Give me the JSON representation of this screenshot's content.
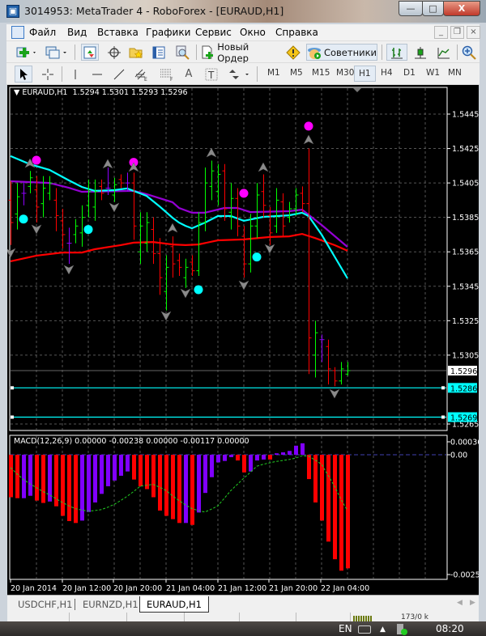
{
  "window": {
    "title": "3014953: MetaTrader 4 - RoboForex - [EURAUD,H1]",
    "min": "—",
    "max": "□",
    "close": "X"
  },
  "menu": [
    "Файл",
    "Вид",
    "Вставка",
    "Графики",
    "Сервис",
    "Окно",
    "Справка"
  ],
  "mdi": {
    "min": "_",
    "restore": "❐",
    "close": "×"
  },
  "toolbar1": {
    "new_order": "Новый Ордер",
    "experts": "Советники"
  },
  "toolbar2": {
    "timeframes": [
      "M1",
      "M5",
      "M15",
      "M30",
      "H1",
      "H4",
      "D1",
      "W1",
      "MN"
    ],
    "active": "H1",
    "fibo_e": "E",
    "fibo_f": "F",
    "text_tool": "A",
    "label_tool": "T"
  },
  "chart": {
    "header": "EURAUD,H1  1.5294 1.5301 1.5293 1.5296",
    "symbol": "EURAUD",
    "timeframe": "H1",
    "price_ticks": [
      "1.5445",
      "1.5425",
      "1.5405",
      "1.5385",
      "1.5365",
      "1.5345",
      "1.5325",
      "1.5305",
      "1.5265"
    ],
    "current_price": "1.5296",
    "hlines": [
      {
        "price": "1.5286",
        "color": "#00ffff"
      },
      {
        "price": "1.5269",
        "color": "#00ffff"
      }
    ],
    "time_labels": [
      "20 Jan 2014",
      "20 Jan 12:00",
      "20 Jan 20:00",
      "21 Jan 04:00",
      "21 Jan 12:00",
      "21 Jan 20:00",
      "22 Jan 04:00"
    ],
    "colors": {
      "up": "#00ff00",
      "down": "#ff0000",
      "doji": "#9000ff",
      "ma_fast": "#00ffff",
      "ma_mid": "#9400d3",
      "ma_slow": "#ff0000",
      "dot_high": "#ff00ff",
      "dot_low": "#00ffff",
      "arrow": "#8a8a8a"
    }
  },
  "chart_data": [
    {
      "type": "ohlc",
      "series": "EURAUD,H1",
      "ylim": [
        1.5262,
        1.5461
      ],
      "ohlc": [
        [
          1.5395,
          1.5406,
          1.5369,
          1.5382
        ],
        [
          1.5387,
          1.5405,
          1.5378,
          1.5397
        ],
        [
          1.5399,
          1.5406,
          1.5392,
          1.5399
        ],
        [
          1.5403,
          1.5412,
          1.5399,
          1.5408
        ],
        [
          1.5401,
          1.5409,
          1.5382,
          1.5391
        ],
        [
          1.5393,
          1.5409,
          1.5385,
          1.5402
        ],
        [
          1.5399,
          1.5409,
          1.5395,
          1.5405
        ],
        [
          1.5395,
          1.5402,
          1.5377,
          1.5386
        ],
        [
          1.5383,
          1.539,
          1.5367,
          1.5375
        ],
        [
          1.537,
          1.5379,
          1.5358,
          1.537
        ],
        [
          1.5375,
          1.5384,
          1.537,
          1.538
        ],
        [
          1.5376,
          1.5392,
          1.5368,
          1.5385
        ],
        [
          1.5392,
          1.5407,
          1.5385,
          1.54
        ],
        [
          1.5391,
          1.5407,
          1.5383,
          1.54
        ],
        [
          1.5403,
          1.5407,
          1.5395,
          1.5399
        ],
        [
          1.5402,
          1.5414,
          1.5398,
          1.5402
        ],
        [
          1.5398,
          1.5408,
          1.5394,
          1.5404
        ],
        [
          1.5407,
          1.541,
          1.5402,
          1.5405
        ],
        [
          1.5405,
          1.5411,
          1.54,
          1.5405
        ],
        [
          1.5405,
          1.5411,
          1.5372,
          1.538
        ],
        [
          1.5365,
          1.5388,
          1.5358,
          1.538
        ],
        [
          1.537,
          1.5388,
          1.5365,
          1.5382
        ],
        [
          1.5378,
          1.5385,
          1.5358,
          1.5364
        ],
        [
          1.5364,
          1.5373,
          1.534,
          1.535
        ],
        [
          1.5342,
          1.5363,
          1.5331,
          1.5356
        ],
        [
          1.5368,
          1.5374,
          1.535,
          1.5358
        ],
        [
          1.536,
          1.5364,
          1.5351,
          1.5356
        ],
        [
          1.535,
          1.5361,
          1.5344,
          1.5356
        ],
        [
          1.5359,
          1.5363,
          1.5351,
          1.5354
        ],
        [
          1.5354,
          1.5388,
          1.5351,
          1.5382
        ],
        [
          1.5382,
          1.5414,
          1.5377,
          1.5405
        ],
        [
          1.5403,
          1.5418,
          1.5395,
          1.5412
        ],
        [
          1.54,
          1.5416,
          1.5392,
          1.541
        ],
        [
          1.5412,
          1.5416,
          1.5383,
          1.539
        ],
        [
          1.5388,
          1.5405,
          1.5378,
          1.5396
        ],
        [
          1.5396,
          1.5402,
          1.5374,
          1.538
        ],
        [
          1.5374,
          1.538,
          1.535,
          1.5358
        ],
        [
          1.5358,
          1.5387,
          1.5353,
          1.538
        ],
        [
          1.538,
          1.5405,
          1.5373,
          1.5398
        ],
        [
          1.54,
          1.541,
          1.5385,
          1.5392
        ],
        [
          1.5386,
          1.5391,
          1.5369,
          1.5376
        ],
        [
          1.538,
          1.5402,
          1.5376,
          1.5395
        ],
        [
          1.5394,
          1.5399,
          1.5374,
          1.538
        ],
        [
          1.5385,
          1.5394,
          1.5382,
          1.539
        ],
        [
          1.539,
          1.5402,
          1.5386,
          1.5398
        ],
        [
          1.5399,
          1.5403,
          1.5388,
          1.5393
        ],
        [
          1.5393,
          1.5425,
          1.5294,
          1.5315
        ],
        [
          1.5305,
          1.5325,
          1.5292,
          1.5318
        ],
        [
          1.5314,
          1.5317,
          1.5301,
          1.5314
        ],
        [
          1.531,
          1.5314,
          1.5288,
          1.5297
        ],
        [
          1.5296,
          1.5298,
          1.5287,
          1.529
        ],
        [
          1.529,
          1.5301,
          1.5288,
          1.5297
        ],
        [
          1.5294,
          1.5301,
          1.5293,
          1.5296
        ]
      ],
      "ma_fast": [
        [
          0,
          1.54206
        ],
        [
          3,
          1.54159
        ],
        [
          6,
          1.54126
        ],
        [
          9,
          1.54065
        ],
        [
          11,
          1.54027
        ],
        [
          13,
          1.54004
        ],
        [
          16,
          1.54008
        ],
        [
          18,
          1.54018
        ],
        [
          21,
          1.53975
        ],
        [
          23,
          1.53914
        ],
        [
          25,
          1.53848
        ],
        [
          26,
          1.5382
        ],
        [
          27,
          1.53801
        ],
        [
          28,
          1.53787
        ],
        [
          30,
          1.5382
        ],
        [
          32,
          1.53858
        ],
        [
          34,
          1.53858
        ],
        [
          36,
          1.5383
        ],
        [
          39,
          1.53853
        ],
        [
          43,
          1.53862
        ],
        [
          45,
          1.53877
        ],
        [
          46,
          1.53858
        ],
        [
          48,
          1.5375
        ],
        [
          50,
          1.53623
        ],
        [
          52,
          1.53496
        ]
      ],
      "ma_mid": [
        [
          0,
          1.5406
        ],
        [
          6,
          1.5405
        ],
        [
          9,
          1.54022
        ],
        [
          11,
          1.53999
        ],
        [
          19,
          1.54004
        ],
        [
          21,
          1.53985
        ],
        [
          25,
          1.53938
        ],
        [
          26,
          1.53905
        ],
        [
          28,
          1.53877
        ],
        [
          30,
          1.53877
        ],
        [
          33,
          1.53905
        ],
        [
          35,
          1.53905
        ],
        [
          37,
          1.53881
        ],
        [
          43,
          1.53886
        ],
        [
          45,
          1.53895
        ],
        [
          48,
          1.53806
        ],
        [
          52,
          1.53679
        ]
      ],
      "ma_slow": [
        [
          0,
          1.53595
        ],
        [
          4,
          1.53628
        ],
        [
          8,
          1.53646
        ],
        [
          11,
          1.53646
        ],
        [
          13,
          1.53665
        ],
        [
          17,
          1.53689
        ],
        [
          19,
          1.53703
        ],
        [
          22,
          1.53707
        ],
        [
          25,
          1.53693
        ],
        [
          27,
          1.53689
        ],
        [
          29,
          1.53693
        ],
        [
          32,
          1.53717
        ],
        [
          36,
          1.53722
        ],
        [
          40,
          1.53736
        ],
        [
          43,
          1.5374
        ],
        [
          45,
          1.53754
        ],
        [
          47,
          1.5373
        ],
        [
          50,
          1.53689
        ],
        [
          52,
          1.53656
        ]
      ],
      "dots_high": [
        [
          4,
          1.54182
        ],
        [
          19,
          1.5417
        ],
        [
          36,
          1.5399
        ],
        [
          46,
          1.5438
        ]
      ],
      "dots_low": [
        [
          2,
          1.5384
        ],
        [
          12,
          1.5378
        ],
        [
          29,
          1.5343
        ],
        [
          38,
          1.5362
        ]
      ],
      "arrows_up": [
        [
          3,
          1.54163
        ],
        [
          15,
          1.54159
        ],
        [
          19,
          1.5414
        ],
        [
          25,
          1.53787
        ],
        [
          31,
          1.54224
        ],
        [
          39,
          1.5414
        ],
        [
          46,
          1.543
        ]
      ],
      "arrows_down": [
        [
          0,
          1.53646
        ],
        [
          4,
          1.53783
        ],
        [
          9,
          1.53548
        ],
        [
          16,
          1.5391
        ],
        [
          24,
          1.5328
        ],
        [
          27,
          1.53411
        ],
        [
          36,
          1.53458
        ],
        [
          40,
          1.5367
        ],
        [
          50,
          1.52828
        ]
      ]
    },
    {
      "type": "bar",
      "title": "MACD(12,26,9) 0.00000 -0.00238 0.00000 -0.00117 0.00000",
      "ylim": [
        -0.00251,
        0.00036
      ],
      "y_ticks": [
        "0.00036",
        "0.00",
        "-0.00251"
      ],
      "histogram": [
        -0.00089,
        -0.00091,
        -0.00091,
        -0.00086,
        -0.00096,
        -0.00101,
        -0.00098,
        -0.00108,
        -0.00128,
        -0.00139,
        -0.00143,
        -0.00138,
        -0.0012,
        -0.001,
        -0.00082,
        -0.00066,
        -0.00054,
        -0.00044,
        -0.00035,
        -0.00052,
        -0.00066,
        -0.00072,
        -0.00089,
        -0.00117,
        -0.00128,
        -0.00135,
        -0.00143,
        -0.00143,
        -0.00147,
        -0.00121,
        -0.0008,
        -0.00047,
        -0.00016,
        -0.00013,
        -5e-05,
        -0.00012,
        -0.00037,
        -0.00035,
        -0.00012,
        -0.0001,
        -0.0001,
        3e-05,
        5e-05,
        8e-05,
        0.00019,
        0.00024,
        -0.00051,
        -0.001,
        -0.00138,
        -0.00182,
        -0.00219,
        -0.00243,
        -0.00238
      ],
      "histogram_colors": [
        "r",
        "r",
        "p",
        "p",
        "r",
        "r",
        "p",
        "r",
        "r",
        "r",
        "r",
        "p",
        "p",
        "p",
        "p",
        "p",
        "p",
        "p",
        "p",
        "r",
        "r",
        "r",
        "r",
        "r",
        "r",
        "r",
        "r",
        "p",
        "r",
        "p",
        "p",
        "p",
        "p",
        "p",
        "p",
        "r",
        "r",
        "p",
        "p",
        "p",
        "r",
        "p",
        "p",
        "p",
        "p",
        "p",
        "r",
        "r",
        "r",
        "r",
        "r",
        "r",
        "r"
      ],
      "signal": [
        -0.00027,
        -0.0004,
        -0.00052,
        -0.00061,
        -0.00069,
        -0.00077,
        -0.00084,
        -0.00092,
        -0.001,
        -0.00107,
        -0.00113,
        -0.00116,
        -0.00118,
        -0.00117,
        -0.00115,
        -0.0011,
        -0.00104,
        -0.00096,
        -0.00087,
        -0.00077,
        -0.00066,
        -0.00064,
        -0.00062,
        -0.00068,
        -0.00075,
        -0.00086,
        -0.00096,
        -0.00105,
        -0.00113,
        -0.00117,
        -0.0012,
        -0.00114,
        -0.00107,
        -0.00091,
        -0.00075,
        -0.00062,
        -0.00049,
        -0.00037,
        -0.00024,
        -0.0002,
        -0.00017,
        -0.00014,
        -0.00012,
        -0.0001,
        -7e-05,
        -2e-05,
        -3e-05,
        -0.00011,
        -0.0002,
        -0.00043,
        -0.00066,
        -0.00094,
        -0.00117
      ],
      "colors": {
        "r": "#ff0000",
        "p": "#8000ff",
        "signal": "#22cc22",
        "zero": "#4040b0"
      }
    }
  ],
  "tabs": [
    {
      "label": "USDCHF,H1"
    },
    {
      "label": "EURNZD,H1"
    },
    {
      "label": "EURAUD,H1",
      "active": true
    }
  ],
  "statusbar": {
    "traffic": "173/0 k"
  },
  "taskbar": {
    "lang": "EN",
    "time": "08:20"
  }
}
